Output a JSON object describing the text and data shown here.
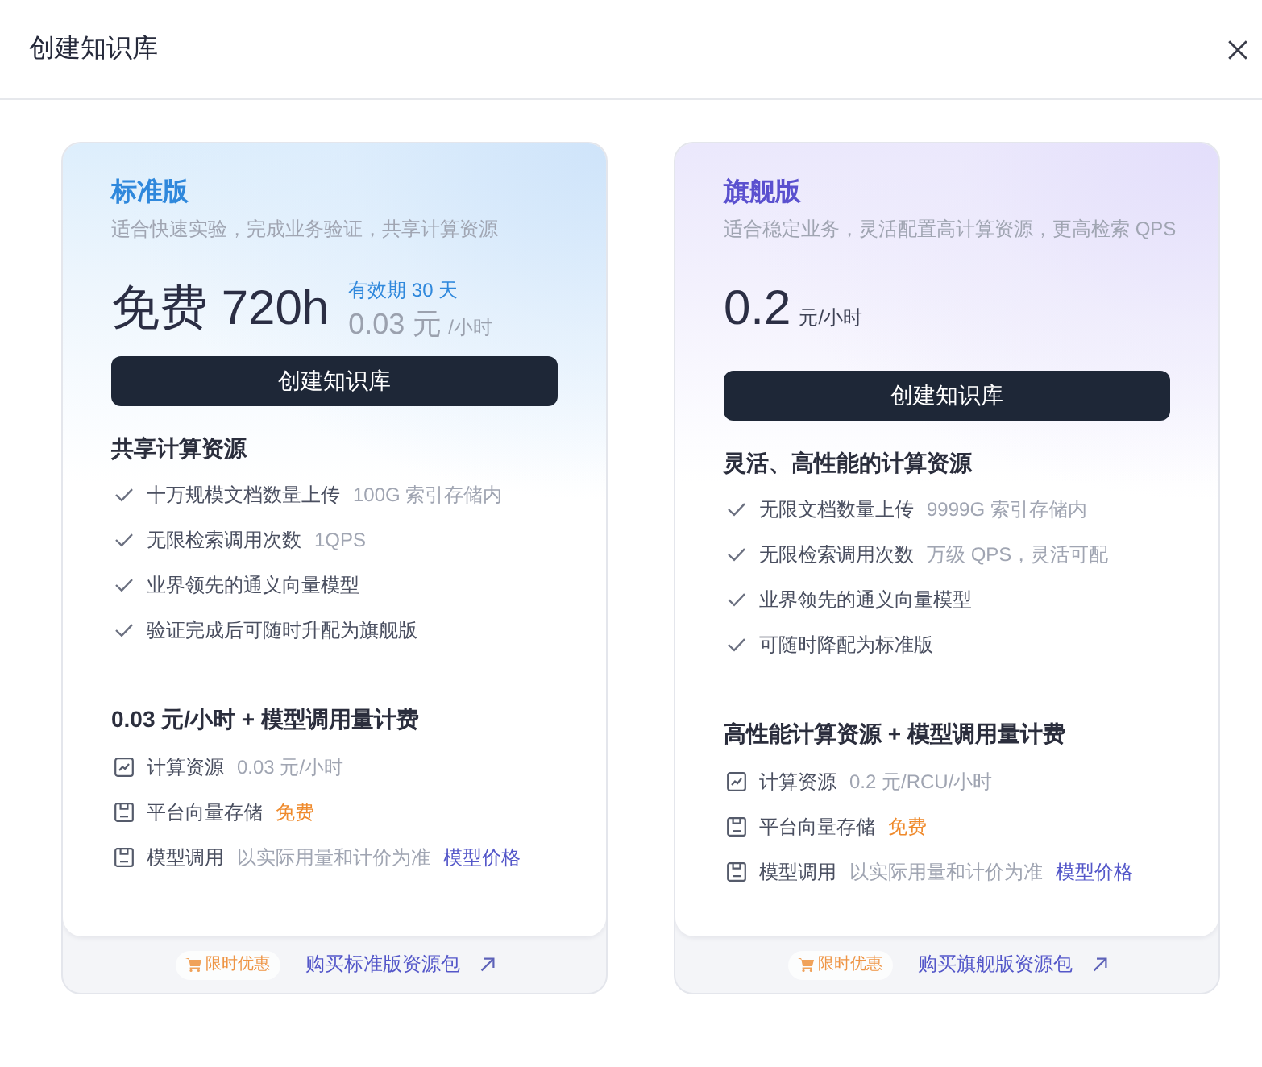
{
  "dialog": {
    "title": "创建知识库"
  },
  "plans": [
    {
      "kind": "standard",
      "name": "标准版",
      "description": "适合快速实验，完成业务验证，共享计算资源",
      "price": {
        "amount": "免费 720h",
        "validity": "有效期 30 天",
        "rate": "0.03 元",
        "rate_unit": "/小时"
      },
      "button": "创建知识库",
      "features_heading": "共享计算资源",
      "features": [
        {
          "text": "十万规模文档数量上传",
          "note": "100G 索引存储内"
        },
        {
          "text": "无限检索调用次数",
          "note": "1QPS"
        },
        {
          "text": "业界领先的通义向量模型"
        },
        {
          "text": "验证完成后可随时升配为旗舰版"
        }
      ],
      "billing_heading": "0.03 元/小时 + 模型调用量计费",
      "billing_items": [
        {
          "kind": "compute",
          "label": "计算资源",
          "value": "0.03 元/小时"
        },
        {
          "kind": "storage",
          "label": "平台向量存储",
          "highlight": "免费"
        },
        {
          "kind": "model",
          "label": "模型调用",
          "value": "以实际用量和计价为准",
          "link": "模型价格"
        }
      ],
      "footer": {
        "badge": "限时优惠",
        "link": "购买标准版资源包"
      }
    },
    {
      "kind": "flagship",
      "name": "旗舰版",
      "description": "适合稳定业务，灵活配置高计算资源，更高检索 QPS",
      "price": {
        "amount": "0.2",
        "unit": "元/小时"
      },
      "button": "创建知识库",
      "features_heading": "灵活、高性能的计算资源",
      "features": [
        {
          "text": "无限文档数量上传",
          "note": "9999G 索引存储内"
        },
        {
          "text": "无限检索调用次数",
          "note": "万级 QPS，灵活可配"
        },
        {
          "text": "业界领先的通义向量模型"
        },
        {
          "text": "可随时降配为标准版"
        }
      ],
      "billing_heading": "高性能计算资源 + 模型调用量计费",
      "billing_items": [
        {
          "kind": "compute",
          "label": "计算资源",
          "value": "0.2 元/RCU/小时"
        },
        {
          "kind": "storage",
          "label": "平台向量存储",
          "highlight": "免费"
        },
        {
          "kind": "model",
          "label": "模型调用",
          "value": "以实际用量和计价为准",
          "link": "模型价格"
        }
      ],
      "footer": {
        "badge": "限时优惠",
        "link": "购买旗舰版资源包"
      }
    }
  ]
}
